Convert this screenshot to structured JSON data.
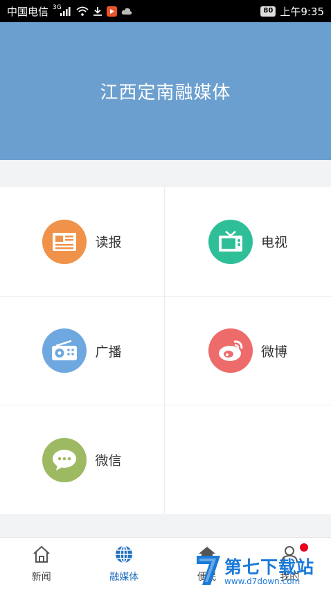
{
  "status_bar": {
    "carrier": "中国电信",
    "network_badge": "3G",
    "battery": "80",
    "time": "上午9:35"
  },
  "header": {
    "title": "江西定南融媒体"
  },
  "grid": {
    "items": [
      {
        "label": "读报",
        "icon": "newspaper-icon",
        "color": "#f0924a"
      },
      {
        "label": "电视",
        "icon": "tv-icon",
        "color": "#2fbf98"
      },
      {
        "label": "广播",
        "icon": "radio-icon",
        "color": "#6fa8e0"
      },
      {
        "label": "微博",
        "icon": "weibo-icon",
        "color": "#ee6b6b"
      },
      {
        "label": "微信",
        "icon": "wechat-icon",
        "color": "#9dba63"
      }
    ]
  },
  "tabbar": {
    "tabs": [
      {
        "label": "新闻",
        "icon": "home-icon"
      },
      {
        "label": "融媒体",
        "icon": "globe-icon",
        "active": true
      },
      {
        "label": "便民",
        "icon": "service-icon"
      },
      {
        "label": "我的",
        "icon": "user-icon",
        "badge": true
      }
    ],
    "active_color": "#1f6fc0"
  },
  "watermark": {
    "name": "第七下载站",
    "url": "www.d7down.com"
  }
}
